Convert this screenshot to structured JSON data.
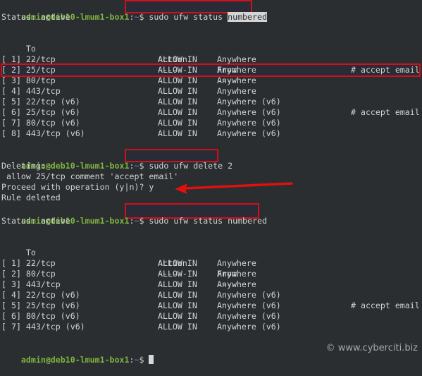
{
  "prompt": {
    "user_host": "admin@deb10-lmum1-box1",
    "sep": ":",
    "path": "~",
    "symbol": "$ "
  },
  "block1": {
    "command_prefix": "sudo ufw status ",
    "command_highlight": "numbered",
    "status": "Status: active",
    "headers": {
      "to": "     To",
      "action": "Action",
      "from": "From"
    },
    "underlines": {
      "to": "     --",
      "action": "------",
      "from": "----"
    },
    "rows": [
      {
        "num": "[ 1]",
        "to": "22/tcp",
        "action": "ALLOW IN",
        "from": "Anywhere",
        "comment": ""
      },
      {
        "num": "[ 2]",
        "to": "25/tcp",
        "action": "ALLOW IN",
        "from": "Anywhere",
        "comment": "# accept email"
      },
      {
        "num": "[ 3]",
        "to": "80/tcp",
        "action": "ALLOW IN",
        "from": "Anywhere",
        "comment": ""
      },
      {
        "num": "[ 4]",
        "to": "443/tcp",
        "action": "ALLOW IN",
        "from": "Anywhere",
        "comment": ""
      },
      {
        "num": "[ 5]",
        "to": "22/tcp (v6)",
        "action": "ALLOW IN",
        "from": "Anywhere (v6)",
        "comment": ""
      },
      {
        "num": "[ 6]",
        "to": "25/tcp (v6)",
        "action": "ALLOW IN",
        "from": "Anywhere (v6)",
        "comment": "# accept email"
      },
      {
        "num": "[ 7]",
        "to": "80/tcp (v6)",
        "action": "ALLOW IN",
        "from": "Anywhere (v6)",
        "comment": ""
      },
      {
        "num": "[ 8]",
        "to": "443/tcp (v6)",
        "action": "ALLOW IN",
        "from": "Anywhere (v6)",
        "comment": ""
      }
    ]
  },
  "block2": {
    "command": "sudo ufw delete 2",
    "output": [
      "Deleting:",
      " allow 25/tcp comment 'accept email'",
      "Proceed with operation (y|n)? y",
      "Rule deleted"
    ]
  },
  "block3": {
    "command": "sudo ufw status numbered",
    "status": "Status: active",
    "headers": {
      "to": "     To",
      "action": "Action",
      "from": "From"
    },
    "underlines": {
      "to": "     --",
      "action": "------",
      "from": "----"
    },
    "rows": [
      {
        "num": "[ 1]",
        "to": "22/tcp",
        "action": "ALLOW IN",
        "from": "Anywhere",
        "comment": ""
      },
      {
        "num": "[ 2]",
        "to": "80/tcp",
        "action": "ALLOW IN",
        "from": "Anywhere",
        "comment": ""
      },
      {
        "num": "[ 3]",
        "to": "443/tcp",
        "action": "ALLOW IN",
        "from": "Anywhere",
        "comment": ""
      },
      {
        "num": "[ 4]",
        "to": "22/tcp (v6)",
        "action": "ALLOW IN",
        "from": "Anywhere (v6)",
        "comment": ""
      },
      {
        "num": "[ 5]",
        "to": "25/tcp (v6)",
        "action": "ALLOW IN",
        "from": "Anywhere (v6)",
        "comment": "# accept email"
      },
      {
        "num": "[ 6]",
        "to": "80/tcp (v6)",
        "action": "ALLOW IN",
        "from": "Anywhere (v6)",
        "comment": ""
      },
      {
        "num": "[ 7]",
        "to": "443/tcp (v6)",
        "action": "ALLOW IN",
        "from": "Anywhere (v6)",
        "comment": ""
      }
    ]
  },
  "watermark": "© www.cyberciti.biz",
  "annotation_color": "#d0101a"
}
